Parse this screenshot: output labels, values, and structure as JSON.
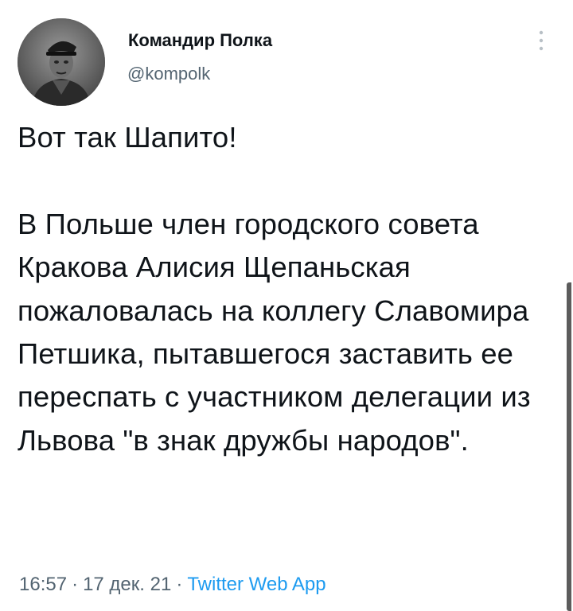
{
  "author": {
    "display_name": "Командир Полка",
    "handle": "@kompolk",
    "avatar_icon": "avatar-portrait-icon"
  },
  "menu": {
    "more_icon": "more-vertical-icon"
  },
  "tweet": {
    "text": "Вот так Шапито!\n\nВ Польше член городского совета Кракова Алисия Щепаньская пожаловалась на коллегу Славомира Петшика, пытавшегося заставить ее переспать с участником делегации из Львова \"в знак дружбы народов\"."
  },
  "meta": {
    "time": "16:57",
    "separator": "·",
    "date": "17 дек. 21",
    "source": "Twitter Web App"
  },
  "colors": {
    "text": "#0f1419",
    "secondary": "#536471",
    "link": "#1d9bf0",
    "scrollbar": "#5c5c5c"
  }
}
